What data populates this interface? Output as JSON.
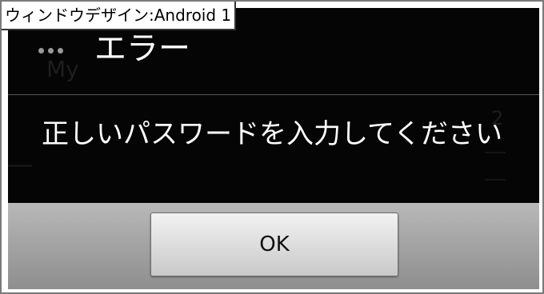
{
  "caption": "ウィンドウデザイン:Android 1",
  "dialog": {
    "title": "エラー",
    "message": "正しいパスワードを入力してください",
    "ok_label": "OK"
  },
  "background_app": {
    "faint_label": "My",
    "faint_count": "2"
  },
  "colors": {
    "dialog_bg": "#050505",
    "title_text": "#ffffff",
    "button_bar": "#a3a3a3"
  }
}
